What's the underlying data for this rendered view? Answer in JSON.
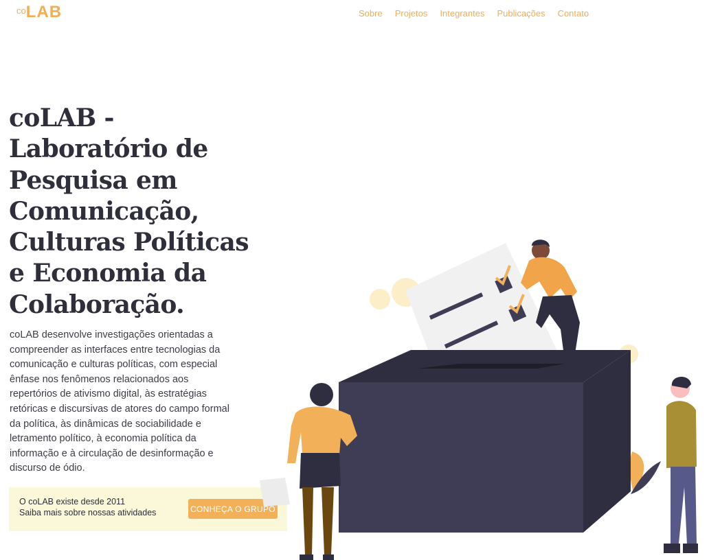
{
  "header": {
    "logo_co": "co",
    "logo_lab": "LAB",
    "nav": [
      "Sobre",
      "Projetos",
      "Integrantes",
      "Publicações",
      "Contato"
    ]
  },
  "hero": {
    "title": "coLAB - Laboratório de Pesquisa em Comunicação, Culturas Políticas e Economia da Colaboração.",
    "description": "coLAB desenvolve investigações orientadas a compreender as interfaces entre tecnologias da comunicação e culturas políticas, com especial ênfase nos fenômenos relacionados aos repertórios de ativismo digital, às estratégias retóricas e discursivas de atores do campo formal da política, às dinâmicas de sociabilidade e letramento político, à economia política da informação e à circulação de desinformação e discurso de ódio."
  },
  "cta": {
    "line1": "O coLAB existe desde 2011",
    "line2": "Saiba mais sobre nossas atividades",
    "button": "CONHEÇA O GRUPO"
  },
  "colors": {
    "accent": "#f2ad55",
    "heading": "#2f2f3b",
    "cta_background": "#fbf7d9",
    "ballot_box": "#3f3d56",
    "ballot_box_side": "#2f2e41"
  }
}
